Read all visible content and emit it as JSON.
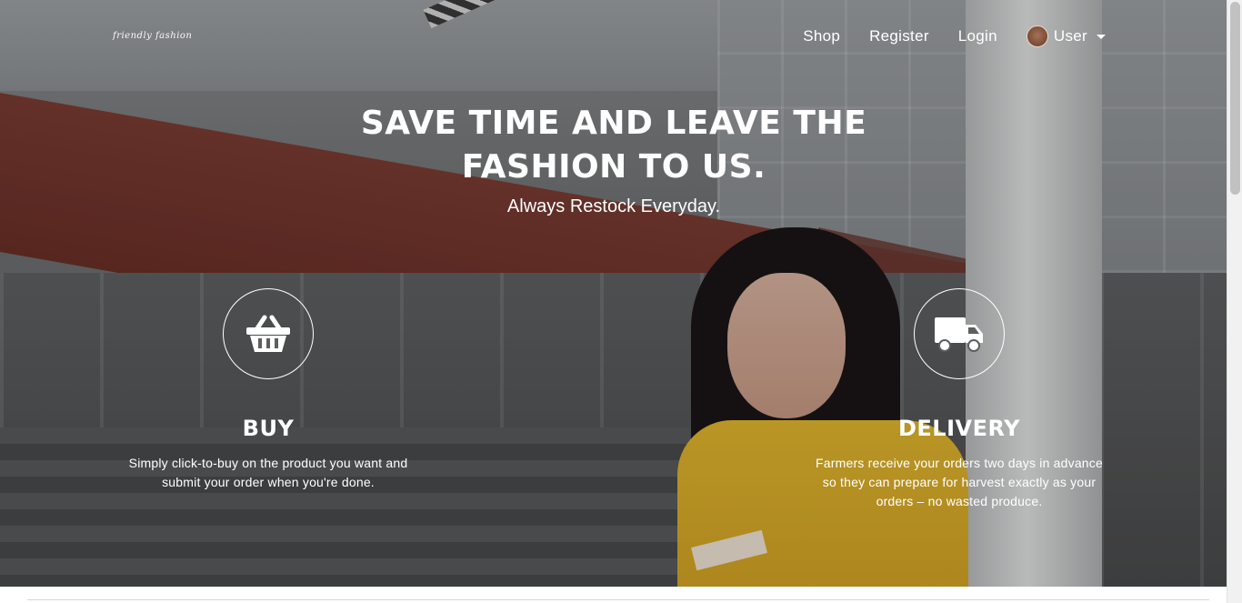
{
  "brand": {
    "logo_text": "friendly fashion"
  },
  "nav": {
    "links": [
      "Shop",
      "Register",
      "Login"
    ],
    "user_label": "User"
  },
  "hero": {
    "headline_line1": "SAVE TIME AND LEAVE THE",
    "headline_line2": "FASHION TO US.",
    "subheadline": "Always Restock Everyday."
  },
  "features": [
    {
      "icon": "basket-icon",
      "title": "BUY",
      "text": "Simply click-to-buy on the product you want and submit your order when you're done."
    },
    {
      "icon": "truck-icon",
      "title": "DELIVERY",
      "text": "Farmers receive your orders two days in advance so they can prepare for harvest exactly as your orders – no wasted produce."
    }
  ],
  "colors": {
    "text": "#ffffff",
    "shirt_yellow": "#e2b72e",
    "facade_red": "#6a2f27"
  }
}
